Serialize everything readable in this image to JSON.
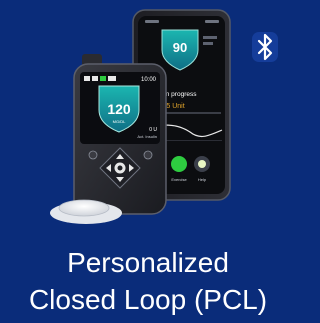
{
  "colors": {
    "background": "#0a2c7a",
    "shield": "#1aa3a3",
    "progress_accent": "#e0a32a",
    "bluetooth": "#ffffff"
  },
  "icons": [
    "bluetooth-icon",
    "shield-icon",
    "arrow-up-icon",
    "arrow-down-icon",
    "arrow-left-icon",
    "arrow-right-icon",
    "back-icon",
    "bolus-icon"
  ],
  "phone": {
    "glucose_value": "90",
    "bolus_line1": "r bolus in progress",
    "bolus_line2": "0 of 0.75 Unit",
    "buttons": [
      "Exercise",
      "Help"
    ]
  },
  "pump": {
    "time": "10:00",
    "glucose_value": "120",
    "glucose_unit": "MG/DL",
    "iob_value": "0 U",
    "iob_label": "Act. Insulin"
  },
  "caption": {
    "line1": "Personalized",
    "line2": "Closed Loop (PCL)"
  }
}
